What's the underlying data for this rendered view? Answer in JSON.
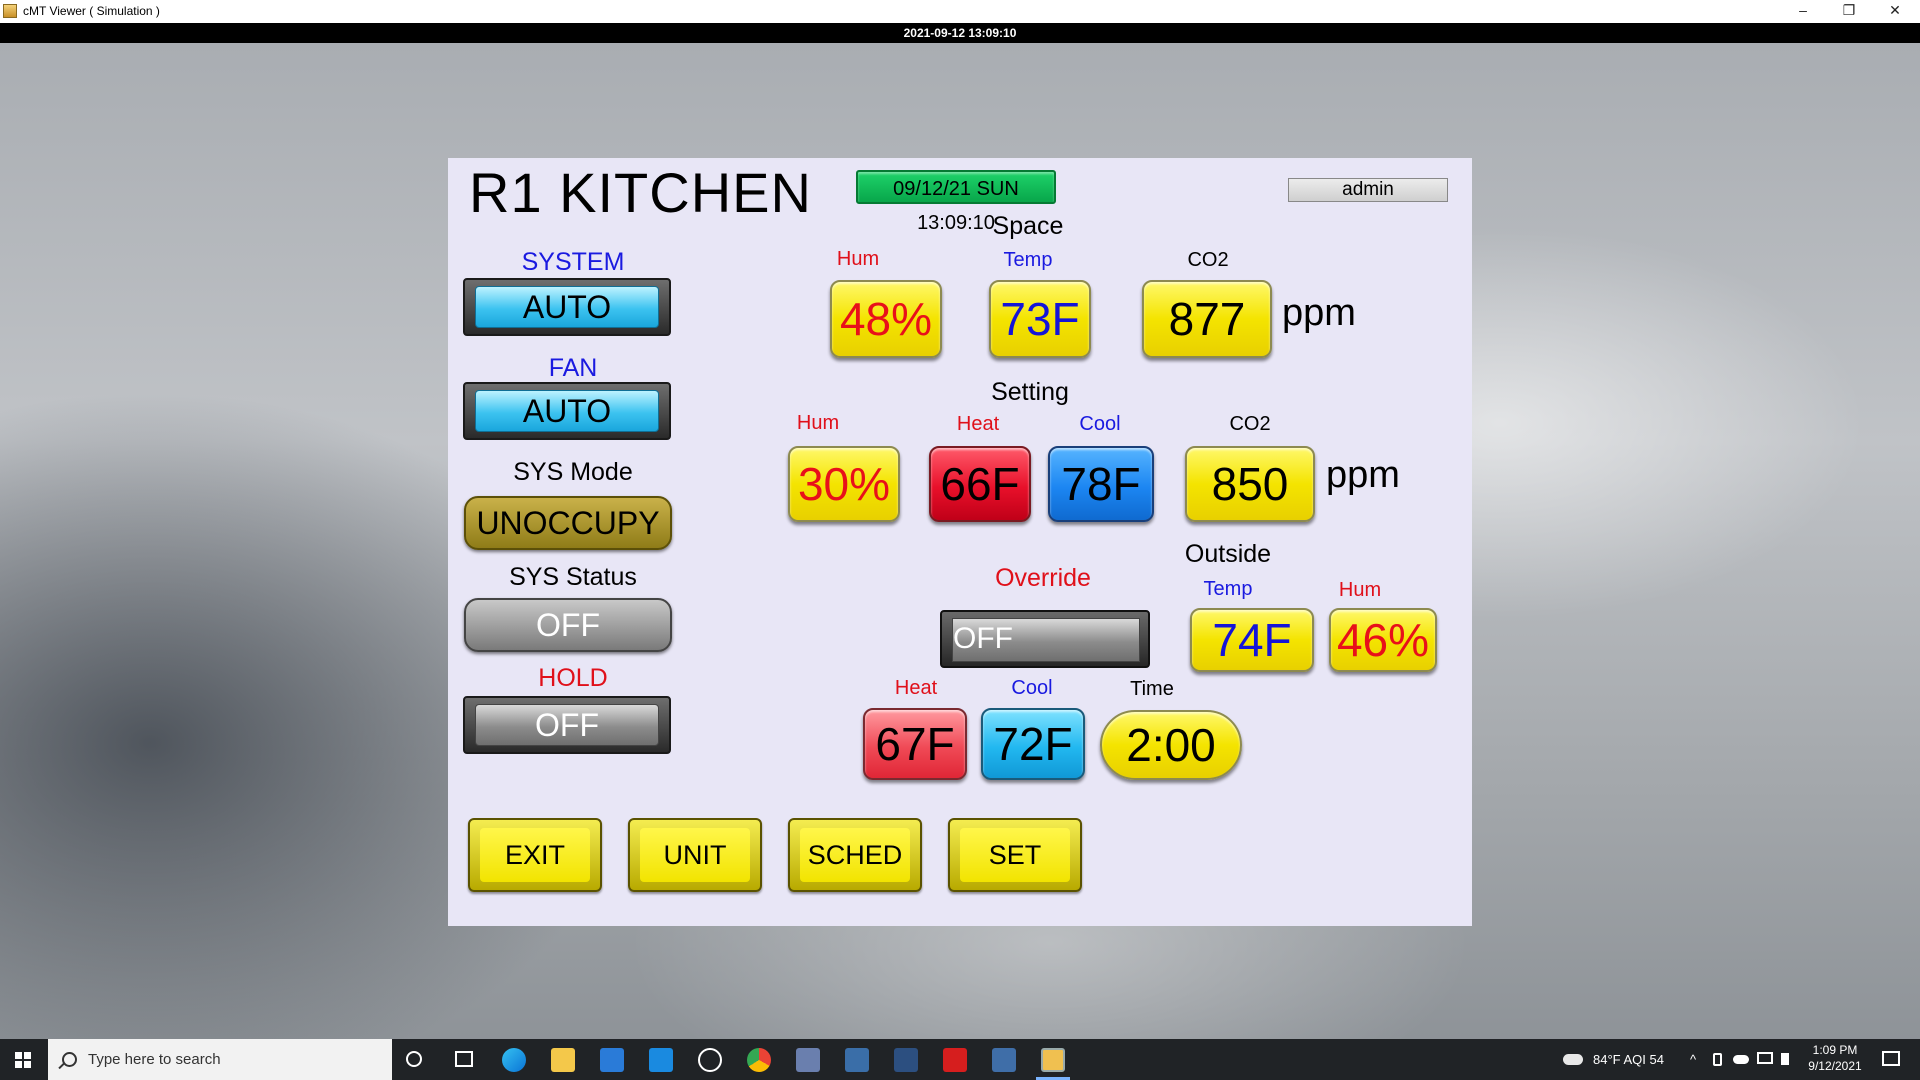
{
  "window": {
    "title": "cMT Viewer ( Simulation )",
    "minimize": "–",
    "restore": "❐",
    "close": "✕",
    "datetime_bar": "2021-09-12 13:09:10"
  },
  "panel": {
    "title": "R1 KITCHEN",
    "clock": "09/12/21 SUN 13:09:10",
    "user": "admin",
    "left": {
      "system_label": "SYSTEM",
      "system_value": "AUTO",
      "fan_label": "FAN",
      "fan_value": "AUTO",
      "sys_mode_label": "SYS Mode",
      "sys_mode_value": "UNOCCUPY",
      "sys_status_label": "SYS Status",
      "sys_status_value": "OFF",
      "hold_label": "HOLD",
      "hold_value": "OFF"
    },
    "space": {
      "label": "Space",
      "hum_label": "Hum",
      "hum_value": "48%",
      "temp_label": "Temp",
      "temp_value": "73F",
      "co2_label": "CO2",
      "co2_value": "877",
      "co2_unit": "ppm"
    },
    "setting": {
      "label": "Setting",
      "hum_label": "Hum",
      "hum_value": "30%",
      "heat_label": "Heat",
      "heat_value": "66F",
      "cool_label": "Cool",
      "cool_value": "78F",
      "co2_label": "CO2",
      "co2_value": "850",
      "co2_unit": "ppm"
    },
    "outside": {
      "label": "Outside",
      "temp_label": "Temp",
      "temp_value": "74F",
      "hum_label": "Hum",
      "hum_value": "46%"
    },
    "override": {
      "label": "Override",
      "value": "OFF",
      "heat_label": "Heat",
      "heat_value": "67F",
      "cool_label": "Cool",
      "cool_value": "72F",
      "time_label": "Time",
      "time_value": "2:00"
    },
    "nav": {
      "exit": "EXIT",
      "unit": "UNIT",
      "sched": "SCHED",
      "set": "SET"
    }
  },
  "taskbar": {
    "search_placeholder": "Type here to search",
    "weather": "84°F  AQI 54",
    "time": "1:09 PM",
    "date": "9/12/2021"
  },
  "colors": {
    "label_red": "#e0101a",
    "label_blue": "#1a1ae0",
    "tile_yellow": "#f4e400",
    "tile_red": "#e8102a",
    "tile_blue": "#1c86f2",
    "clock_green": "#08a64a"
  }
}
